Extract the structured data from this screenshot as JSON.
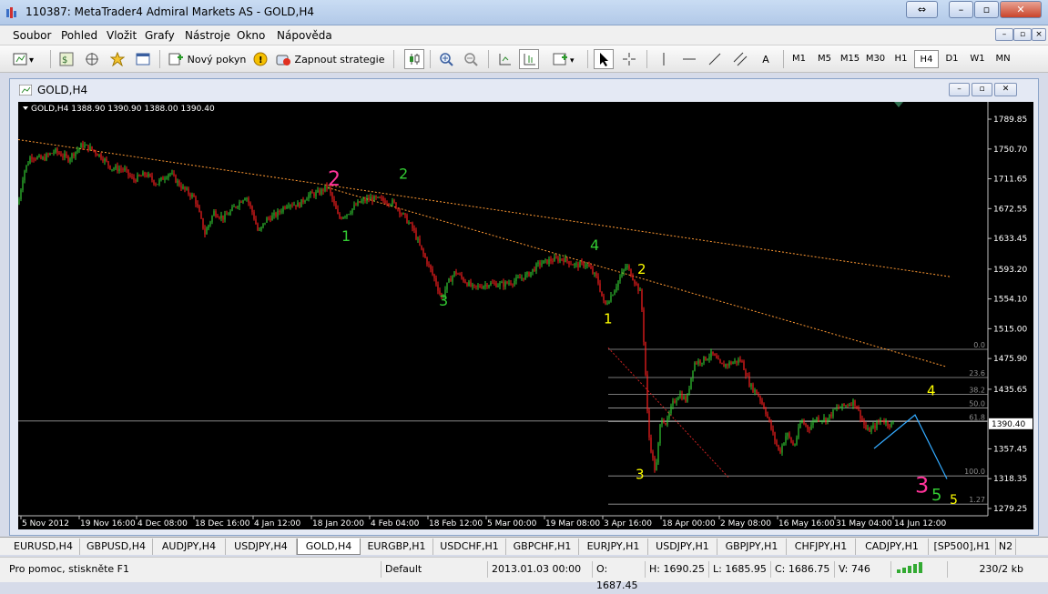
{
  "window": {
    "title": "110387: MetaTrader4 Admiral Markets AS - GOLD,H4"
  },
  "menu": [
    "Soubor",
    "Pohled",
    "Vložit",
    "Grafy",
    "Nástroje",
    "Okno",
    "Nápověda"
  ],
  "toolbar": {
    "new_order": "Nový pokyn",
    "autotrading": "Zapnout strategie",
    "text_tool": "A",
    "timeframes": [
      "M1",
      "M5",
      "M15",
      "M30",
      "H1",
      "H4",
      "D1",
      "W1",
      "MN"
    ],
    "active_timeframe": "H4"
  },
  "chart_window": {
    "title": "GOLD,H4"
  },
  "chart_data": {
    "type": "candlestick",
    "symbol_info": "GOLD,H4  1388.90 1390.90 1388.00 1390.40",
    "current_price": "1390.40",
    "y_ticks": [
      "1789.85",
      "1750.70",
      "1711.65",
      "1672.55",
      "1633.45",
      "1593.20",
      "1554.10",
      "1515.00",
      "1475.90",
      "1435.65",
      "1357.45",
      "1318.35",
      "1279.25"
    ],
    "x_ticks": [
      "5 Nov 2012",
      "19 Nov 16:00",
      "4 Dec 08:00",
      "18 Dec 16:00",
      "4 Jan 12:00",
      "18 Jan 20:00",
      "4 Feb 04:00",
      "18 Feb 12:00",
      "5 Mar 00:00",
      "19 Mar 08:00",
      "3 Apr 16:00",
      "18 Apr 00:00",
      "2 May 08:00",
      "16 May 16:00",
      "31 May 04:00",
      "14 Jun 12:00"
    ],
    "fib_levels": [
      "0.0",
      "23.6",
      "38.2",
      "50.0",
      "61.8",
      "100.0",
      "1.27"
    ],
    "wave_labels": [
      {
        "text": "2",
        "color": "#ff3399"
      },
      {
        "text": "1",
        "color": "#33cc33"
      },
      {
        "text": "2",
        "color": "#33cc33"
      },
      {
        "text": "3",
        "color": "#33cc33"
      },
      {
        "text": "4",
        "color": "#33cc33"
      },
      {
        "text": "1",
        "color": "#ffff00"
      },
      {
        "text": "2",
        "color": "#ffff00"
      },
      {
        "text": "3",
        "color": "#ffff00"
      },
      {
        "text": "4",
        "color": "#ffff00"
      },
      {
        "text": "3",
        "color": "#ff3399"
      },
      {
        "text": "5",
        "color": "#33cc33"
      },
      {
        "text": "5",
        "color": "#ffff00"
      }
    ],
    "price_path": [
      [
        0,
        1678
      ],
      [
        6,
        1720
      ],
      [
        14,
        1742
      ],
      [
        26,
        1737
      ],
      [
        40,
        1748
      ],
      [
        55,
        1738
      ],
      [
        70,
        1756
      ],
      [
        80,
        1751
      ],
      [
        92,
        1740
      ],
      [
        102,
        1726
      ],
      [
        116,
        1724
      ],
      [
        126,
        1710
      ],
      [
        140,
        1718
      ],
      [
        152,
        1705
      ],
      [
        166,
        1720
      ],
      [
        180,
        1700
      ],
      [
        194,
        1686
      ],
      [
        205,
        1640
      ],
      [
        215,
        1668
      ],
      [
        226,
        1660
      ],
      [
        238,
        1675
      ],
      [
        250,
        1690
      ],
      [
        258,
        1665
      ],
      [
        264,
        1640
      ],
      [
        272,
        1658
      ],
      [
        284,
        1665
      ],
      [
        296,
        1680
      ],
      [
        308,
        1677
      ],
      [
        318,
        1690
      ],
      [
        330,
        1693
      ],
      [
        340,
        1702
      ],
      [
        352,
        1660
      ],
      [
        362,
        1667
      ],
      [
        374,
        1680
      ],
      [
        386,
        1686
      ],
      [
        398,
        1684
      ],
      [
        412,
        1680
      ],
      [
        424,
        1662
      ],
      [
        434,
        1645
      ],
      [
        442,
        1620
      ],
      [
        450,
        1600
      ],
      [
        458,
        1578
      ],
      [
        465,
        1555
      ],
      [
        472,
        1575
      ],
      [
        480,
        1590
      ],
      [
        490,
        1578
      ],
      [
        500,
        1568
      ],
      [
        516,
        1574
      ],
      [
        532,
        1573
      ],
      [
        546,
        1578
      ],
      [
        560,
        1586
      ],
      [
        572,
        1600
      ],
      [
        586,
        1605
      ],
      [
        598,
        1607
      ],
      [
        612,
        1598
      ],
      [
        624,
        1600
      ],
      [
        636,
        1580
      ],
      [
        644,
        1545
      ],
      [
        652,
        1560
      ],
      [
        660,
        1580
      ],
      [
        668,
        1598
      ],
      [
        676,
        1580
      ],
      [
        684,
        1560
      ],
      [
        688,
        1480
      ],
      [
        692,
        1380
      ],
      [
        696,
        1350
      ],
      [
        700,
        1325
      ],
      [
        706,
        1400
      ],
      [
        712,
        1390
      ],
      [
        718,
        1415
      ],
      [
        726,
        1430
      ],
      [
        734,
        1420
      ],
      [
        742,
        1470
      ],
      [
        752,
        1474
      ],
      [
        762,
        1482
      ],
      [
        772,
        1466
      ],
      [
        782,
        1470
      ],
      [
        794,
        1474
      ],
      [
        804,
        1440
      ],
      [
        812,
        1430
      ],
      [
        820,
        1410
      ],
      [
        828,
        1380
      ],
      [
        836,
        1352
      ],
      [
        844,
        1378
      ],
      [
        852,
        1360
      ],
      [
        860,
        1395
      ],
      [
        868,
        1384
      ],
      [
        876,
        1398
      ],
      [
        888,
        1396
      ],
      [
        898,
        1410
      ],
      [
        908,
        1414
      ],
      [
        918,
        1420
      ],
      [
        926,
        1398
      ],
      [
        932,
        1380
      ],
      [
        940,
        1386
      ],
      [
        948,
        1396
      ],
      [
        956,
        1390
      ],
      [
        962,
        1391
      ]
    ],
    "projection": [
      [
        940,
        1358
      ],
      [
        985,
        1402
      ],
      [
        1020,
        1318
      ]
    ]
  },
  "symbol_tabs": [
    "EURUSD,H4",
    "GBPUSD,H4",
    "AUDJPY,H4",
    "USDJPY,H4",
    "GOLD,H4",
    "EURGBP,H1",
    "USDCHF,H1",
    "GBPCHF,H1",
    "EURJPY,H1",
    "USDJPY,H1",
    "GBPJPY,H1",
    "CHFJPY,H1",
    "CADJPY,H1",
    "[SP500],H1",
    "N2"
  ],
  "active_tab": "GOLD,H4",
  "status": {
    "help": "Pro pomoc, stiskněte F1",
    "profile": "Default",
    "datetime": "2013.01.03 00:00",
    "open": "O: 1687.45",
    "high": "H: 1690.25",
    "low": "L: 1685.95",
    "close": "C: 1686.75",
    "volume": "V: 746",
    "traffic": "230/2 kb"
  },
  "colors": {
    "bull": "#33cc33",
    "bear": "#ff2020",
    "background": "#000000",
    "grid": "#a0a0a0",
    "trendline": "#ff9933",
    "projection": "#33aaff"
  }
}
